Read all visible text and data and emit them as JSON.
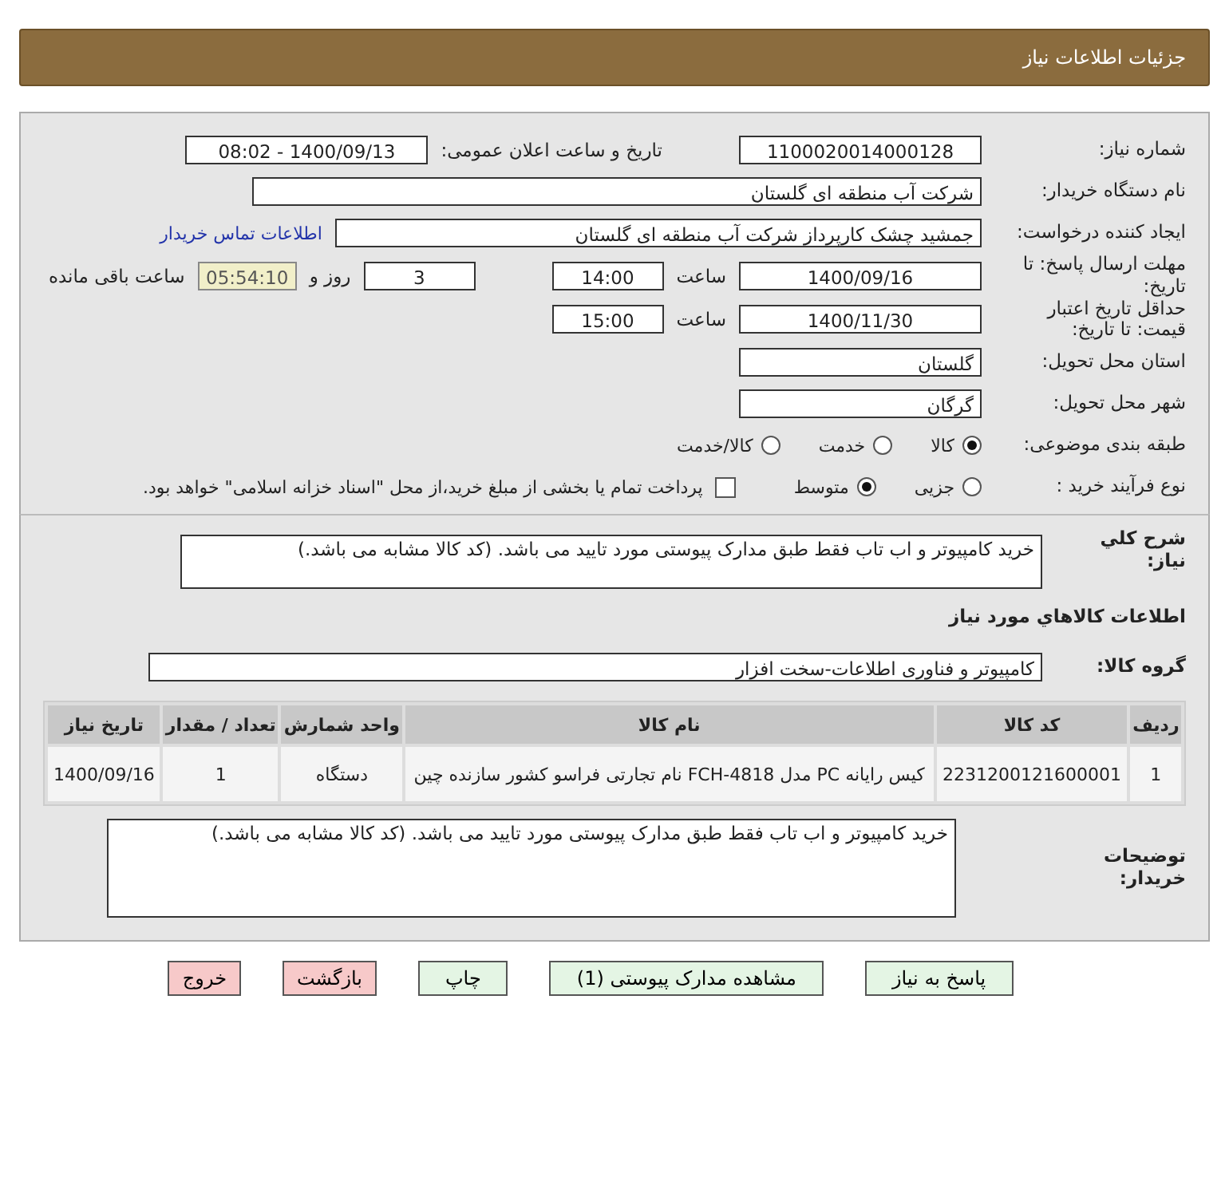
{
  "header": {
    "title": "جزئیات اطلاعات نیاز"
  },
  "need_number": {
    "label": "شماره نیاز:",
    "value": "1100020014000128"
  },
  "announce": {
    "label": "تاریخ و ساعت اعلان عمومی:",
    "value": "1400/09/13 - 08:02"
  },
  "buyer": {
    "label": "نام دستگاه خریدار:",
    "value": "شرکت آب منطقه ای گلستان"
  },
  "creator": {
    "label": "ایجاد کننده درخواست:",
    "value": "جمشید چشک کارپرداز شرکت آب منطقه ای گلستان",
    "link": "اطلاعات تماس خریدار"
  },
  "deadline": {
    "label": "مهلت ارسال پاسخ: تا تاریخ:",
    "date": "1400/09/16",
    "time_label": "ساعت",
    "time": "14:00",
    "days": "3",
    "days_label": "روز و",
    "remaining": "05:54:10",
    "remaining_label": "ساعت باقی مانده"
  },
  "validity": {
    "label": "حداقل تاریخ اعتبار قیمت: تا تاریخ:",
    "date": "1400/11/30",
    "time_label": "ساعت",
    "time": "15:00"
  },
  "province": {
    "label": "استان محل تحویل:",
    "value": "گلستان"
  },
  "city": {
    "label": "شهر محل تحویل:",
    "value": "گرگان"
  },
  "category": {
    "label": "طبقه بندی موضوعی:",
    "options": [
      {
        "label": "کالا",
        "selected": true
      },
      {
        "label": "خدمت",
        "selected": false
      },
      {
        "label": "کالا/خدمت",
        "selected": false
      }
    ]
  },
  "process": {
    "label": "نوع فرآیند خرید :",
    "options": [
      {
        "label": "جزیی",
        "selected": false
      },
      {
        "label": "متوسط",
        "selected": true
      }
    ],
    "payment": {
      "checked": false,
      "label": "پرداخت تمام یا بخشی از مبلغ خرید،از محل \"اسناد خزانه اسلامی\" خواهد بود."
    }
  },
  "description": {
    "label": "شرح کلي نیاز:",
    "value": "خرید کامپیوتر و اب تاب فقط طبق مدارک پیوستی مورد تایید می باشد. (کد کالا مشابه می باشد.)"
  },
  "goods_heading": "اطلاعات کالاهاي مورد نیاز",
  "goods_group": {
    "label": "گروه کالا:",
    "value": "کامپیوتر و فناوری اطلاعات-سخت افزار"
  },
  "table": {
    "columns": [
      "ردیف",
      "کد کالا",
      "نام کالا",
      "واحد شمارش",
      "تعداد / مقدار",
      "تاریخ نیاز"
    ],
    "rows": [
      [
        "1",
        "2231200121600001",
        "کیس رایانه PC مدل FCH-4818 نام تجارتی فراسو کشور سازنده چین",
        "دستگاه",
        "1",
        "1400/09/16"
      ]
    ]
  },
  "buyer_notes": {
    "label": "توضیحات خریدار:",
    "value": "خرید کامپیوتر و اب تاب فقط طبق مدارک پیوستی مورد تایید می باشد. (کد کالا مشابه می باشد.)"
  },
  "buttons": [
    {
      "label": "پاسخ به نیاز",
      "kind": "normal"
    },
    {
      "label": "مشاهده مدارک پیوستی (1)",
      "kind": "normal"
    },
    {
      "label": "چاپ",
      "kind": "normal"
    },
    {
      "label": "بازگشت",
      "kind": "danger"
    },
    {
      "label": "خروج",
      "kind": "danger"
    }
  ]
}
